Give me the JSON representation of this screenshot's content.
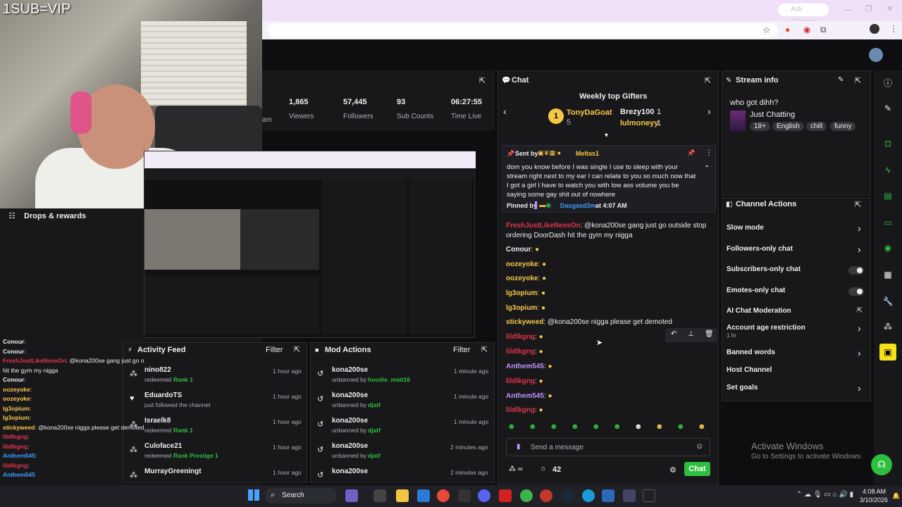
{
  "webcam": {
    "overlay_text": "1SUB=VIP"
  },
  "browser": {
    "ask_chrome": "Ask Chrome"
  },
  "drops": {
    "label": "Drops & rewards"
  },
  "stats": [
    {
      "value": "1,865",
      "label": "Viewers"
    },
    {
      "value": "57,445",
      "label": "Followers"
    },
    {
      "value": "93",
      "label": "Sub Counts"
    },
    {
      "value": "06:27:55",
      "label": "Time Live"
    }
  ],
  "stat_partial": "am",
  "chat": {
    "title": "Chat",
    "gifters_title": "Weekly top Gifters",
    "gifters": [
      {
        "name": "TonyDaGoat",
        "count": "5"
      },
      {
        "name": "Brezy100",
        "count": "1"
      },
      {
        "name": "lulmoneyy",
        "count": "1"
      }
    ],
    "pinned": {
      "sent_by": "Sent by",
      "sender": "Meltas1",
      "message": "dom you know before I was single I use to sleep with your stream right next to my ear I can relate to you so much now that I got a girl I have to watch you with low ass volume you be saying some gay shit out of nowhere",
      "pinned_by": "Pinned by",
      "pinner": "Dasgasd3m",
      "pinned_at": "at 4:07 AM"
    },
    "messages": [
      {
        "user": "FreshJustLikeNessOn",
        "text": ": @kona200se gang just go outside stop ordering DoorDash hit the gym my nigga"
      },
      {
        "user": "Conour",
        "text": ":"
      },
      {
        "user": "oozeyoke",
        "text": ":"
      },
      {
        "user": "oozeyoke",
        "text": ":"
      },
      {
        "user": "lg3opium",
        "text": ":"
      },
      {
        "user": "lg3opium",
        "text": ":"
      },
      {
        "user": "stickyweed",
        "text": ": @kona200se nigga please get demoted"
      },
      {
        "user": "lildlkgng",
        "text": ":"
      },
      {
        "user": "lildlkgng",
        "text": ":"
      },
      {
        "user": "Anthem545",
        "text": ":"
      },
      {
        "user": "lildlkgng",
        "text": ":"
      },
      {
        "user": "Anthem545",
        "text": ":"
      },
      {
        "user": "lildlkgng",
        "text": ":"
      }
    ],
    "input_placeholder": "Send a message",
    "points": "42",
    "chat_button": "Chat"
  },
  "stream_info": {
    "title": "Stream info",
    "stream_title": "who got dihh?",
    "category": "Just Chatting",
    "tags": [
      "18+",
      "English",
      "chill",
      "funny"
    ]
  },
  "channel_actions": {
    "title": "Channel Actions",
    "items": [
      {
        "label": "Slow mode",
        "control": "chevron"
      },
      {
        "label": "Followers-only chat",
        "control": "chevron"
      },
      {
        "label": "Subscribers-only chat",
        "control": "toggle"
      },
      {
        "label": "Emotes-only chat",
        "control": "toggle"
      },
      {
        "label": "AI Chat Moderation",
        "control": "external"
      },
      {
        "label": "Account age restriction",
        "sub": "1 hr",
        "control": "chevron"
      },
      {
        "label": "Banned words",
        "control": "chevron"
      },
      {
        "label": "Host Channel",
        "control": "none"
      },
      {
        "label": "Set goals",
        "control": "chevron"
      }
    ]
  },
  "activity_feed": {
    "title": "Activity Feed",
    "filter": "Filter",
    "items": [
      {
        "user": "nino822",
        "action": "redeemed",
        "detail": "Rank 1",
        "time": "1 hour ago"
      },
      {
        "user": "EduardoTS",
        "action": "just followed the channel",
        "detail": "",
        "time": "1 hour ago"
      },
      {
        "user": "Israelk8",
        "action": "redeemed",
        "detail": "Rank 1",
        "time": "1 hour ago"
      },
      {
        "user": "Culoface21",
        "action": "redeemed",
        "detail": "Rank Prestige 1",
        "time": "1 hour ago"
      },
      {
        "user": "MurrayGreeningt",
        "action": "",
        "detail": "",
        "time": "1 hour ago"
      }
    ]
  },
  "mod_actions": {
    "title": "Mod Actions",
    "filter": "Filter",
    "items": [
      {
        "user": "kona200se",
        "action": "unbanned by",
        "mod": "hoodie_matt16",
        "time": "1 minute ago"
      },
      {
        "user": "kona200se",
        "action": "unbanned by",
        "mod": "djatf",
        "time": "1 minute ago"
      },
      {
        "user": "kona200se",
        "action": "unbanned by",
        "mod": "djatf",
        "time": "1 minute ago"
      },
      {
        "user": "kona200se",
        "action": "unbanned by",
        "mod": "djatf",
        "time": "2 minutes ago"
      },
      {
        "user": "kona200se",
        "action": "",
        "mod": "",
        "time": "2 minutes ago"
      }
    ]
  },
  "overlay_chat": [
    {
      "user": "Conour",
      "text": ":"
    },
    {
      "user": "Conour",
      "text": ":"
    },
    {
      "user": "FreshJustLikeNessOn",
      "text": ": @kona200se gang just go outside stop ordering DoorDash"
    },
    {
      "user": "",
      "text": "hit the gym my nigga"
    },
    {
      "user": "Conour",
      "text": ":"
    },
    {
      "user": "oozeyoke",
      "text": ":"
    },
    {
      "user": "oozeyoke",
      "text": ":"
    },
    {
      "user": "lg3opium",
      "text": ":"
    },
    {
      "user": "lg3opium",
      "text": ":"
    },
    {
      "user": "stickyweed",
      "text": ": @kona200se nigga please get demoted"
    },
    {
      "user": "lildlkgng",
      "text": ":"
    },
    {
      "user": "lildlkgng",
      "text": ":"
    },
    {
      "user": "Anthem545",
      "text": ":"
    },
    {
      "user": "lildlkgng",
      "text": ":"
    },
    {
      "user": "Anthem545",
      "text": ""
    }
  ],
  "watermark": {
    "line1": "Activate Windows",
    "line2": "Go to Settings to activate Windows."
  },
  "taskbar": {
    "search": "Search",
    "time": "4:08 AM",
    "date": "3/10/2026"
  },
  "colors": {
    "accent": "#2fbf3f",
    "panel": "#18181b",
    "bg": "#0e0e10",
    "mod_red": "#e0344a",
    "gold": "#f6c744"
  }
}
